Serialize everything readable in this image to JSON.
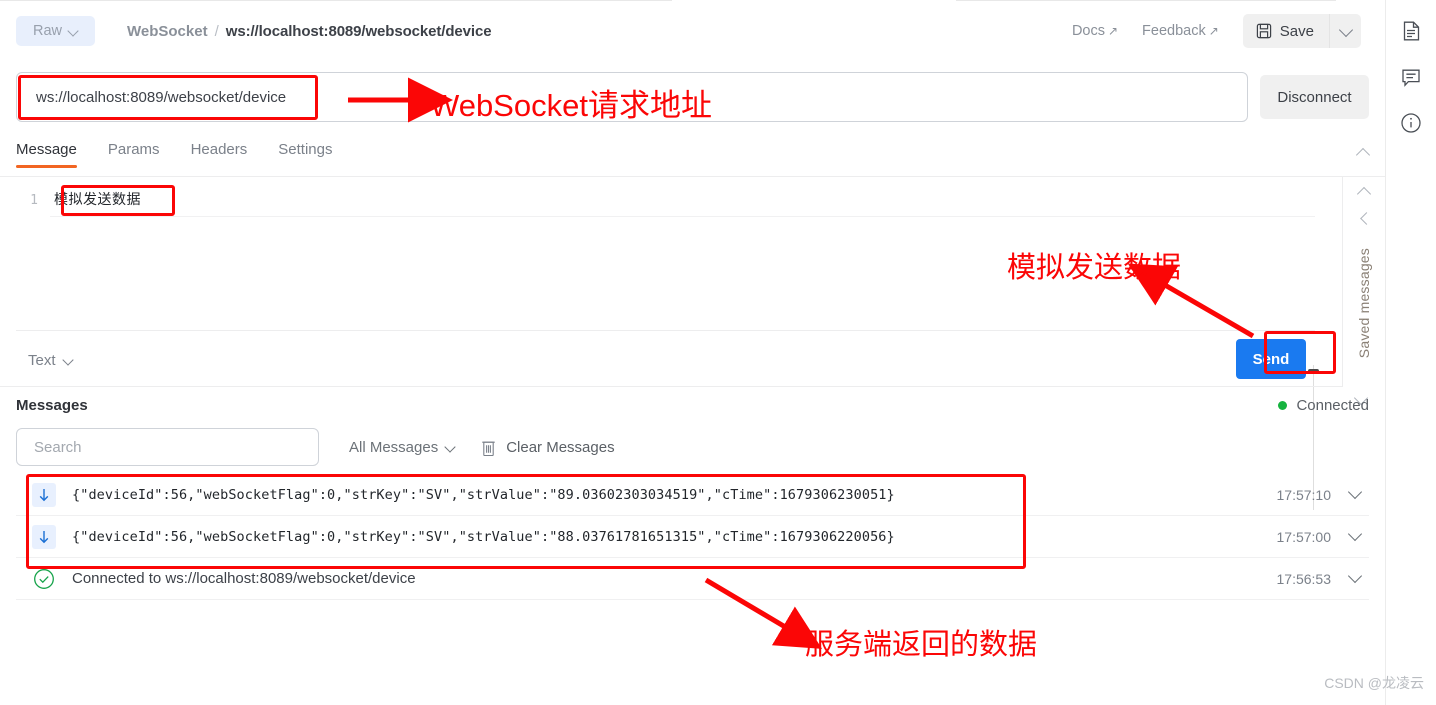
{
  "header": {
    "mode_chip": "Raw",
    "breadcrumb_protocol": "WebSocket",
    "breadcrumb_separator": "/",
    "breadcrumb_url": "ws://localhost:8089/websocket/device",
    "docs_label": "Docs",
    "docs_arrow": "↗",
    "feedback_label": "Feedback",
    "feedback_arrow": "↗",
    "save_label": "Save"
  },
  "url_bar": {
    "value": "ws://localhost:8089/websocket/device",
    "placeholder": "ws://localhost:8089/websocket/device",
    "connect_button": "Disconnect"
  },
  "tabs": [
    {
      "label": "Message",
      "active": true
    },
    {
      "label": "Params",
      "active": false
    },
    {
      "label": "Headers",
      "active": false
    },
    {
      "label": "Settings",
      "active": false
    }
  ],
  "editor": {
    "line_number": "1",
    "content": "模拟发送数据",
    "format_label": "Text",
    "send_label": "Send"
  },
  "saved_rail": {
    "label": "Saved messages"
  },
  "messages_panel": {
    "title": "Messages",
    "status_text": "Connected",
    "status_color": "#16b33f",
    "search_placeholder": "Search",
    "search_value": "",
    "filter_label": "All Messages",
    "clear_label": "Clear Messages",
    "rows": [
      {
        "kind": "incoming",
        "icon": "arrow-down-icon",
        "text": "{\"deviceId\":56,\"webSocketFlag\":0,\"strKey\":\"SV\",\"strValue\":\"89.03602303034519\",\"cTime\":1679306230051}",
        "time": "17:57:10"
      },
      {
        "kind": "incoming",
        "icon": "arrow-down-icon",
        "text": "{\"deviceId\":56,\"webSocketFlag\":0,\"strKey\":\"SV\",\"strValue\":\"88.03761781651315\",\"cTime\":1679306220056}",
        "time": "17:57:00"
      },
      {
        "kind": "system",
        "icon": "check-circle-icon",
        "text": "Connected to ws://localhost:8089/websocket/device",
        "time": "17:56:53"
      }
    ]
  },
  "right_rail": {
    "icons": [
      "document-icon",
      "comment-icon",
      "info-icon"
    ]
  },
  "annotations": {
    "accent_color": "#fb0606",
    "url_label": "WebSocket请求地址",
    "send_label": "模拟发送数据",
    "response_label": "服务端返回的数据"
  },
  "watermark": "CSDN @龙凌云"
}
